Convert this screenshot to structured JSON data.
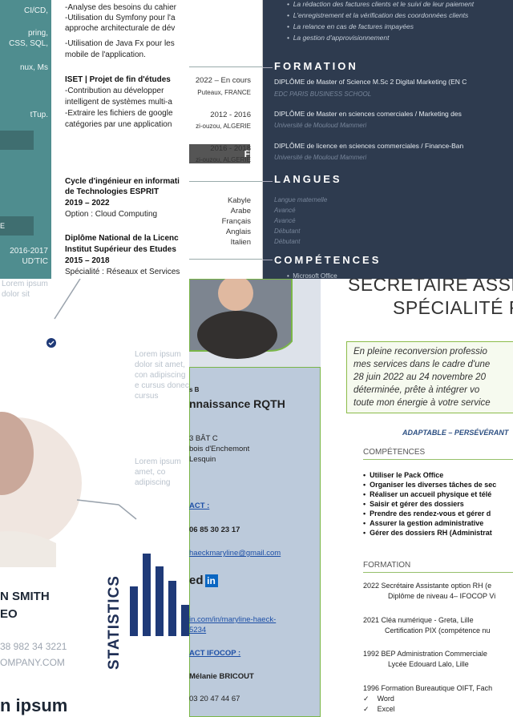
{
  "panel_a": {
    "lines": [
      "CI/CD,",
      "pring,",
      "CSS, SQL,",
      "nux, Ms",
      "tTup."
    ],
    "box1": "",
    "box2": "E",
    "dates": "2016-2017",
    "school": "UD'TIC"
  },
  "panel_b": {
    "l1": "-Analyse des besoins du cahier",
    "l2": "-Utilisation du Symfony pour l'a",
    "l3": "approche architecturale de dév",
    "l4": "-Utilisation de Java Fx pour les",
    "l5": "mobile de l'application.",
    "proj_title": "ISET | Projet de fin d'études",
    "p1": "-Contribution  au  développer",
    "p2": "intelligent de systèmes multi-a",
    "p3": "-Extraire les fichiers de google",
    "p4": "catégories par une application",
    "edu1_title1": "Cycle d'ingénieur en informati",
    "edu1_title2": "de Technologies ESPRIT",
    "edu1_years": "2019 – 2022",
    "edu1_option": "Option : Cloud Computing",
    "edu2_title1": "Diplôme National de la Licenc",
    "edu2_title2": "Institut Supérieur des Etudes",
    "edu2_years": "2015 – 2018",
    "edu2_spec": "Spécialité : Réseaux et Services"
  },
  "panel_c": {
    "d1": "2022 – En cours",
    "d1b": "Puteaux, FRANCE",
    "d2": "2012 - 2016",
    "d2b": "zi-ouzou, ALGERIE",
    "dark_label": "F",
    "d3": "2016 - 2018",
    "d3b": "zi-ouzou, ALGERIE",
    "langs": [
      "Kabyle",
      "Arabe",
      "Français",
      "Anglais",
      "Italien"
    ]
  },
  "panel_d": {
    "bullets": [
      "La rédaction des factures clients et le suivi de leur paiement",
      "L'enregistrement et la vérification des coordonnées clients",
      "La relance en cas de factures impayées",
      "La gestion d'approvisionnement"
    ],
    "formation": "FORMATION",
    "deg1": "DIPLÔME de Master of Science M.Sc 2 Digital Marketing (EN C",
    "sch1": "EDC PARIS BUSINESS SCHOOL",
    "deg2": "DIPLÔME de Master en sciences comerciales / Marketing des",
    "sch2": "Université de Mouloud Mammeri",
    "deg3": "DIPLÔME de licence en sciences commerciales / Finance-Ban",
    "sch3": "Université de Mouloud Mammeri",
    "langues": "LANGUES",
    "levels": [
      "Langue maternelle",
      "Avancé",
      "Avancé",
      "Débutant",
      "Débutant"
    ],
    "competences": "COMPÉTENCES",
    "comp1": "Microsoft Office"
  },
  "panel_e": {
    "lorem1": "Lorem ipsum dolor sit",
    "lorem2": "Lorem ipsum dolor sit amet, con adipiscing e cursus donec cursus",
    "lorem3": "Lorem ipsum amet, co adipiscing",
    "name": "N SMITH",
    "role": "EO",
    "phone": "38 982 34 3221",
    "web": "OMPANY.COM",
    "footer": "n ipsum",
    "stats": "STATISTICS",
    "bars": [
      0.55,
      0.92,
      0.78,
      0.62,
      0.35,
      0.45
    ]
  },
  "panel_f": {
    "small": "s B",
    "title": "nnaissance RQTH",
    "addr1": "3 BÂT C",
    "addr2": "bois d'Enchemont",
    "addr3": "Lesquin",
    "contact": "ACT :",
    "phone": "06 85 30 23 17",
    "email": "haeckmaryline@gmail.com",
    "linkedin": "ed",
    "url1": "in.com/in/maryline-haeck-",
    "url2": "5234",
    "ifocop": "ACT IFOCOP :",
    "person": "Mélanie BRICOUT",
    "phone2": "03 20 47 44 67"
  },
  "panel_g": {
    "title1": "SECRETAIRE ASSIS",
    "title2": "SPÉCIALITÉ F",
    "intro": [
      "En  pleine  reconversion  professio",
      "mes services dans le cadre d'une",
      "28 juin 2022 au 24 novembre 20",
      "déterminée,  prête  à  intégrer  vo",
      "toute mon énergie à votre service"
    ],
    "tagline": "ADAPTABLE – PERSÉVÉRANT",
    "comp_head": "COMPÉTENCES",
    "comp": [
      "Utiliser le Pack Office",
      "Organiser les diverses tâches de sec",
      "Réaliser un accueil physique et télé",
      "Saisir et gérer des dossiers",
      "Prendre des rendez-vous et gérer d",
      "Assurer la gestion administrative",
      "Gérer des dossiers RH (Administrat"
    ],
    "form_head": "FORMATION",
    "f1a": "2022 Secrétaire Assistante option RH (e",
    "f1b": "Diplôme de niveau 4– IFOCOP Vi",
    "f2a": "2021 Cléa numérique - Greta, Lille",
    "f2b": "Certification  PIX (compétence nu",
    "f3a": "1992 BEP Administration Commerciale",
    "f3b": "Lycée Edouard Lalo, Lille",
    "f4a": "1996 Formation Bureautique OIFT, Fach",
    "f4b": "Word",
    "f4c": "Excel"
  }
}
